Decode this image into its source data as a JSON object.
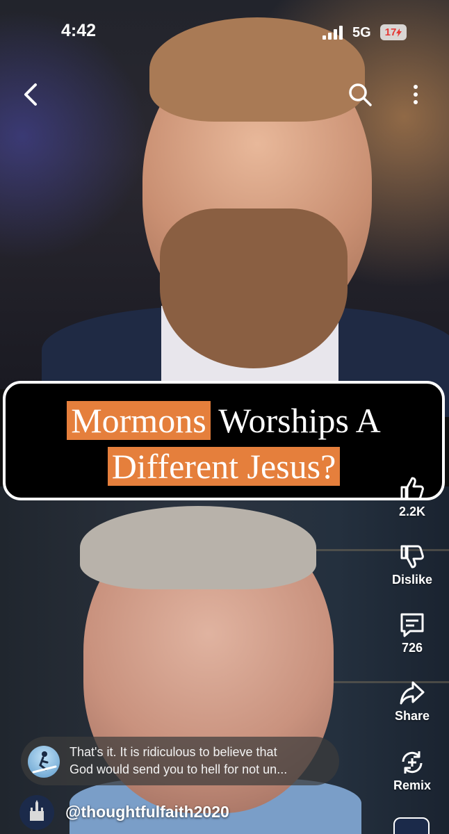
{
  "status_bar": {
    "time": "4:42",
    "network": "5G",
    "battery": "17",
    "battery_color": "#e53935"
  },
  "nav": {
    "back_icon": "chevron-left-icon",
    "search_icon": "search-icon",
    "more_icon": "more-vertical-icon"
  },
  "video": {
    "title_line1_highlight": "Mormons",
    "title_line1_rest": "Worships A",
    "title_line2_highlight": "Different Jesus?",
    "highlight_color": "#e57f3c"
  },
  "actions": {
    "like_count": "2.2K",
    "dislike_label": "Dislike",
    "comment_count": "726",
    "share_label": "Share",
    "remix_label": "Remix"
  },
  "comment_preview": {
    "line1": "That's it. It is ridiculous to believe that",
    "line2": "God would send you to hell for not un..."
  },
  "channel": {
    "handle": "@thoughtfulfaith2020"
  }
}
